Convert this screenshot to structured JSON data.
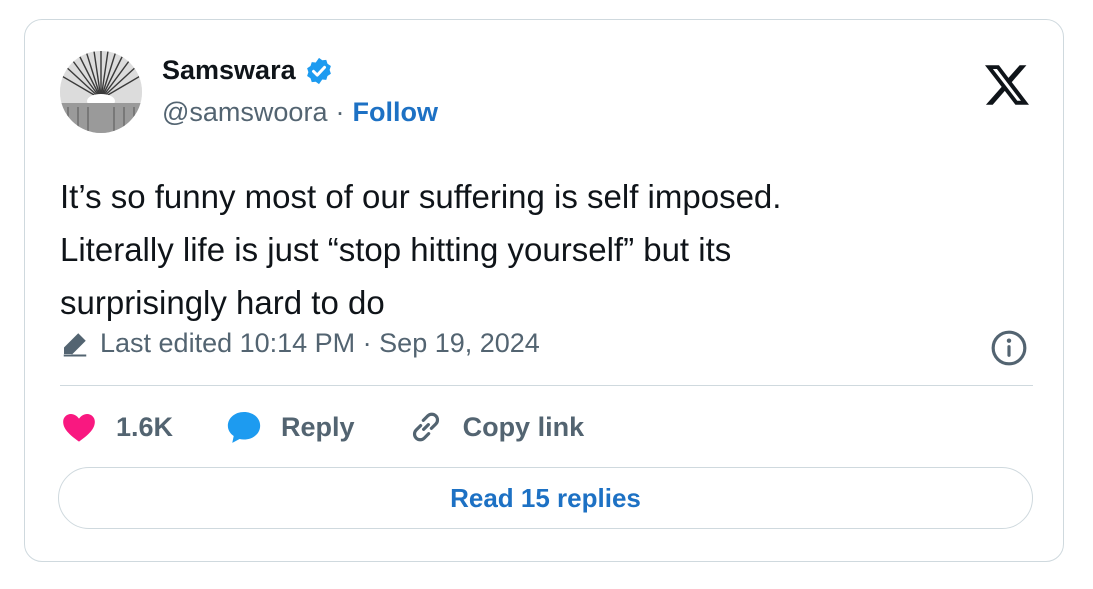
{
  "author": {
    "name": "Samswara",
    "handle": "@samswoora",
    "separator": "·",
    "follow_label": "Follow",
    "verified_color": "#1d9bf0"
  },
  "tweet": {
    "lines": [
      "It’s so funny most of our suffering is self imposed.",
      "Literally life is just “stop hitting yourself” but its",
      "surprisingly hard to do"
    ],
    "edited_text": "Last edited 10:14 PM · Sep 19, 2024"
  },
  "actions": {
    "like_count": "1.6K",
    "reply_label": "Reply",
    "copy_link_label": "Copy link"
  },
  "read_replies_label": "Read 15 replies",
  "colors": {
    "heart": "#f91880",
    "reply_bubble": "#1d9bf0",
    "link_blue": "#1d71c4",
    "muted": "#536471",
    "border": "#cfd9de"
  },
  "icons": [
    "avatar",
    "verified-badge-icon",
    "x-logo-icon",
    "pencil-icon",
    "info-icon",
    "heart-icon",
    "reply-bubble-icon",
    "link-icon"
  ]
}
